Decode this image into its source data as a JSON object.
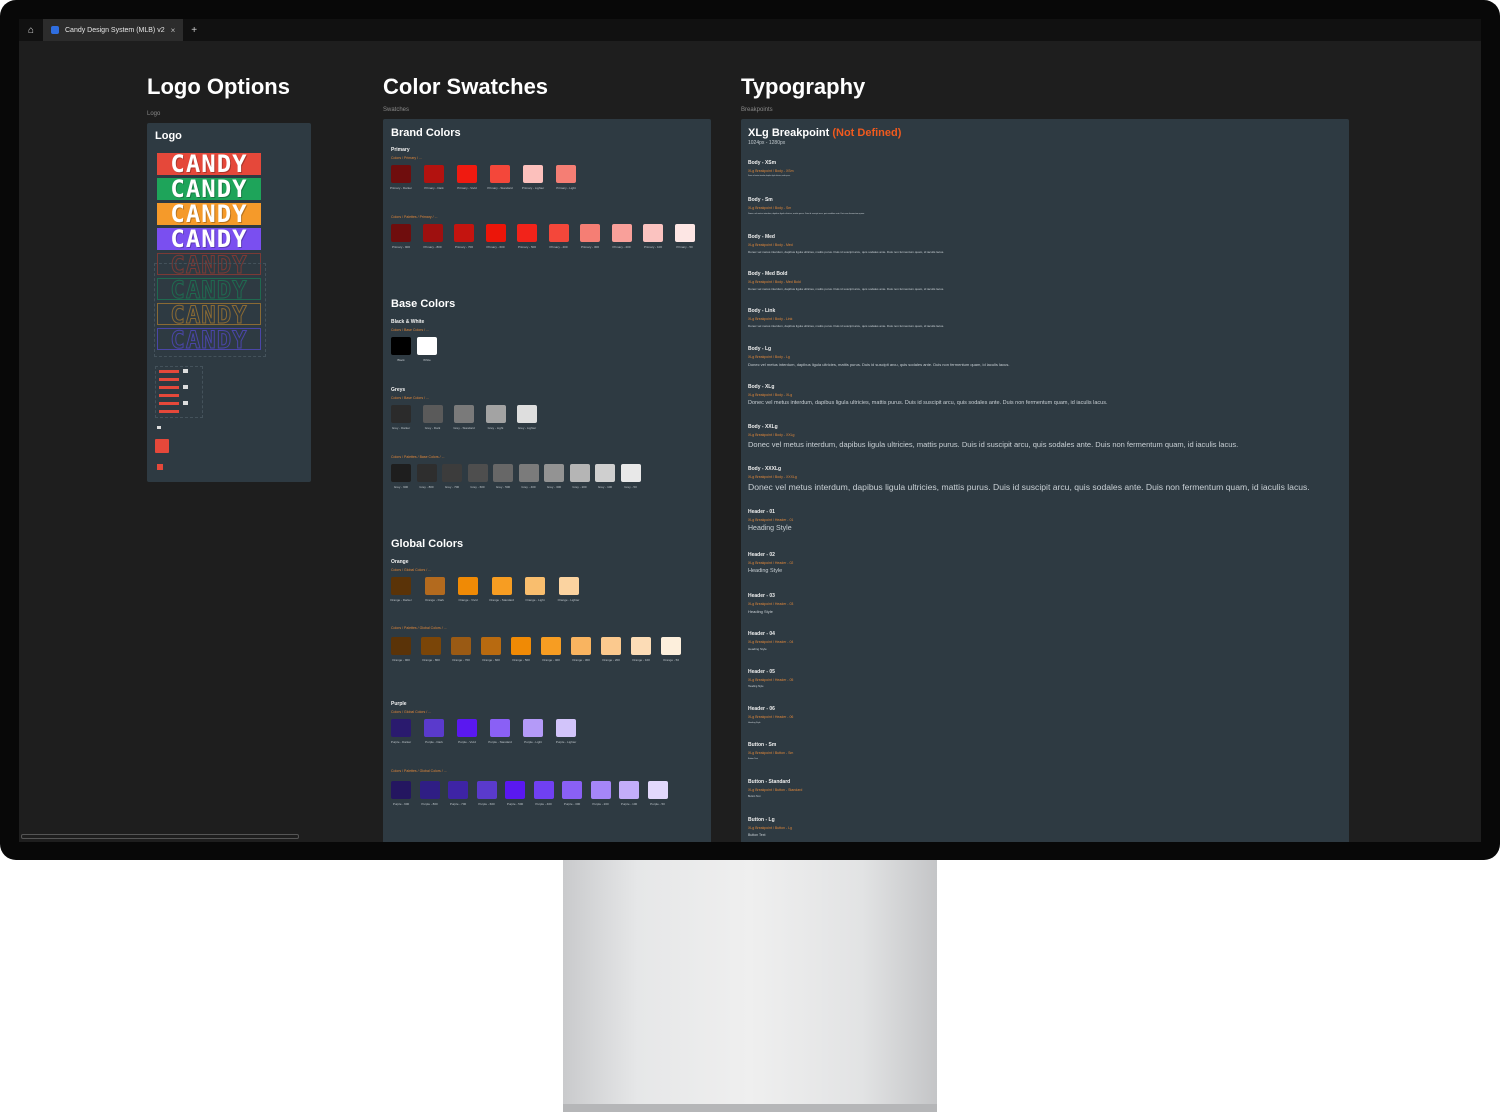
{
  "tab": {
    "title": "Candy Design System (MLB) v2",
    "close": "×",
    "plus": "+"
  },
  "logo_section": {
    "title": "Logo Options",
    "sub": "Logo",
    "panel_title": "Logo",
    "wordmark": "CANDY",
    "filled_colors": [
      "#e5483a",
      "#1ea45a",
      "#f59a2a",
      "#7a4ff0"
    ],
    "outline_colors": [
      "#7a3a36",
      "#1f6a50",
      "#8a6a34",
      "#4a46a8"
    ]
  },
  "swatch_section": {
    "title": "Color Swatches",
    "sub": "Swatches"
  },
  "brand": {
    "title": "Brand Colors",
    "primary_label": "Primary",
    "primary_sub": "Colors / Primary / ...",
    "palette_sub": "Colors / Palettes / Primary / ...",
    "row1": [
      {
        "color": "#6f0d0d",
        "cap": "Primary - Darker"
      },
      {
        "color": "#b3120f",
        "cap": "Primary - Dark"
      },
      {
        "color": "#f01a10",
        "cap": "Primary - Vivid"
      },
      {
        "color": "#f4473a",
        "cap": "Primary - Standard"
      },
      {
        "color": "#fcc0bc",
        "cap": "Primary - Lighter"
      },
      {
        "color": "#f57e74",
        "cap": "Primary - Light"
      }
    ],
    "row2": [
      {
        "color": "#6f0d0d",
        "cap": "Primary - 900"
      },
      {
        "color": "#9e100f",
        "cap": "Primary - 800"
      },
      {
        "color": "#c4140f",
        "cap": "Primary - 700"
      },
      {
        "color": "#ec1509",
        "cap": "Primary - 600"
      },
      {
        "color": "#f2231a",
        "cap": "Primary - 500"
      },
      {
        "color": "#f4473a",
        "cap": "Primary - 400"
      },
      {
        "color": "#f57e74",
        "cap": "Primary - 300"
      },
      {
        "color": "#f9a09a",
        "cap": "Primary - 200"
      },
      {
        "color": "#fbc3c0",
        "cap": "Primary - 100"
      },
      {
        "color": "#fde6e4",
        "cap": "Primary - 50"
      }
    ]
  },
  "base": {
    "title": "Base Colors",
    "bw_label": "Black & White",
    "bw_sub": "Colors / Base Colors / ...",
    "bw": [
      {
        "color": "#000000",
        "cap": "Black"
      },
      {
        "color": "#ffffff",
        "cap": "White"
      }
    ],
    "greys_label": "Greys",
    "greys_sub": "Colors / Base Colors / ...",
    "palette_sub": "Colors / Palettes / Base Colors / ...",
    "greys": [
      {
        "color": "#2b2b2b",
        "cap": "Grey - Darker"
      },
      {
        "color": "#5a5a5a",
        "cap": "Grey - Dark"
      },
      {
        "color": "#7a7a7a",
        "cap": "Grey - Standard"
      },
      {
        "color": "#a3a3a3",
        "cap": "Grey - Light"
      },
      {
        "color": "#dedede",
        "cap": "Grey - Lighter"
      }
    ],
    "greys2": [
      {
        "color": "#1e1e1e",
        "cap": "Grey - 900"
      },
      {
        "color": "#2e2e2e",
        "cap": "Grey - 800"
      },
      {
        "color": "#3c3c3c",
        "cap": "Grey - 700"
      },
      {
        "color": "#4e4e4e",
        "cap": "Grey - 600"
      },
      {
        "color": "#676767",
        "cap": "Grey - 500"
      },
      {
        "color": "#7b7b7b",
        "cap": "Grey - 400"
      },
      {
        "color": "#939393",
        "cap": "Grey - 300"
      },
      {
        "color": "#b5b5b5",
        "cap": "Grey - 200"
      },
      {
        "color": "#cfcfcf",
        "cap": "Grey - 100"
      },
      {
        "color": "#e8e8e8",
        "cap": "Grey - 50"
      }
    ]
  },
  "global": {
    "title": "Global Colors",
    "orange_label": "Orange",
    "orange_sub": "Colors / Global Colors / ...",
    "orange_palette_sub": "Colors / Palettes / Global Colors / ...",
    "orange": [
      {
        "color": "#5a3308",
        "cap": "Orange - Darker"
      },
      {
        "color": "#b36a1e",
        "cap": "Orange - Dark"
      },
      {
        "color": "#f08a05",
        "cap": "Orange - Vivid"
      },
      {
        "color": "#f79d22",
        "cap": "Orange - Standard"
      },
      {
        "color": "#f9be6e",
        "cap": "Orange - Light"
      },
      {
        "color": "#fbd3a0",
        "cap": "Orange - Lighter"
      }
    ],
    "orange2": [
      {
        "color": "#5a3308",
        "cap": "Orange - 900"
      },
      {
        "color": "#7a4508",
        "cap": "Orange - 800"
      },
      {
        "color": "#9a5a14",
        "cap": "Orange - 700"
      },
      {
        "color": "#b86a10",
        "cap": "Orange - 600"
      },
      {
        "color": "#f08a05",
        "cap": "Orange - 500"
      },
      {
        "color": "#f79d22",
        "cap": "Orange - 400"
      },
      {
        "color": "#f9b460",
        "cap": "Orange - 300"
      },
      {
        "color": "#fbc98e",
        "cap": "Orange - 200"
      },
      {
        "color": "#fcdcb6",
        "cap": "Orange - 100"
      },
      {
        "color": "#fdefdc",
        "cap": "Orange - 50"
      }
    ],
    "purple_label": "Purple",
    "purple_sub": "Colors / Global Colors / ...",
    "purple_palette_sub": "Colors / Palettes / Global Colors / ...",
    "purple": [
      {
        "color": "#2a1a6e",
        "cap": "Purple - Darker"
      },
      {
        "color": "#5a3acc",
        "cap": "Purple - Dark"
      },
      {
        "color": "#5a18f0",
        "cap": "Purple - Vivid"
      },
      {
        "color": "#8a60f5",
        "cap": "Purple - Standard"
      },
      {
        "color": "#b49af8",
        "cap": "Purple - Light"
      },
      {
        "color": "#d2c4fa",
        "cap": "Purple - Lighter"
      }
    ],
    "purple2": [
      {
        "color": "#241660",
        "cap": "Purple - 900"
      },
      {
        "color": "#2f1e84",
        "cap": "Purple - 800"
      },
      {
        "color": "#3e24a6",
        "cap": "Purple - 700"
      },
      {
        "color": "#5a3acc",
        "cap": "Purple - 600"
      },
      {
        "color": "#5a18f0",
        "cap": "Purple - 500"
      },
      {
        "color": "#7040f2",
        "cap": "Purple - 400"
      },
      {
        "color": "#8a60f5",
        "cap": "Purple - 300"
      },
      {
        "color": "#a586f7",
        "cap": "Purple - 200"
      },
      {
        "color": "#c3adf9",
        "cap": "Purple - 100"
      },
      {
        "color": "#e2d8fc",
        "cap": "Purple - 50"
      }
    ]
  },
  "typo_section": {
    "title": "Typography",
    "sub": "Breakpoints"
  },
  "typo": {
    "title": "XLg Breakpoint",
    "title_highlight": "(Not Defined)",
    "range": "1024px - 1280px",
    "sample_text": "Donec vel metus interdum, dapibus ligula ultricies, mattis purus. Duis id suscipit arcu, quis sodales ante. Duis non fermentum quam, id iaculis lacus.",
    "items": [
      {
        "label": "Body - XSm",
        "path": "XLg Breakpoint / Body - XSm",
        "sample": "Donec vel metus interdum, dapibus ligula ultricies, mattis purus.",
        "size": 1.5
      },
      {
        "label": "Body - Sm",
        "path": "XLg Breakpoint / Body - Sm",
        "sample": "Donec vel metus interdum, dapibus ligula ultricies, mattis purus. Duis id suscipit arcu, quis sodales ante. Duis non fermentum quam.",
        "size": 2
      },
      {
        "label": "Body - Med",
        "path": "XLg Breakpoint / Body - Med",
        "sample": "Donec vel metus interdum, dapibus ligula ultricies, mattis purus. Duis id suscipit arcu, quis sodales ante. Duis non fermentum quam, id iaculis lacus.",
        "size": 3
      },
      {
        "label": "Body - Med Bold",
        "path": "XLg Breakpoint / Body - Med Bold",
        "sample": "Donec vel metus interdum, dapibus ligula ultricies, mattis purus. Duis id suscipit arcu, quis sodales ante. Duis non fermentum quam, id iaculis lacus.",
        "size": 3
      },
      {
        "label": "Body - Link",
        "path": "XLg Breakpoint / Body - Link",
        "sample": "Donec vel metus interdum, dapibus ligula ultricies, mattis purus. Duis id suscipit arcu, quis sodales ante. Duis non fermentum quam, id iaculis lacus.",
        "size": 3
      },
      {
        "label": "Body - Lg",
        "path": "XLg Breakpoint / Body - Lg",
        "sample": "Donec vel metus interdum, dapibus ligula ultricies, mattis purus. Duis id suscipit arcu, quis sodales ante. Duis non fermentum quam, id iaculis lacus.",
        "size": 4
      },
      {
        "label": "Body - XLg",
        "path": "XLg Breakpoint / Body - XLg",
        "sample": "Donec vel metus interdum, dapibus ligula ultricies, mattis purus. Duis id suscipit arcu, quis sodales ante. Duis non fermentum quam, id iaculis lacus.",
        "size": 5.5
      },
      {
        "label": "Body - XXLg",
        "path": "XLg Breakpoint / Body - XXLg",
        "sample": "Donec vel metus interdum, dapibus ligula ultricies, mattis purus. Duis id suscipit arcu, quis sodales ante. Duis non fermentum quam, id iaculis lacus.",
        "size": 7.5
      },
      {
        "label": "Body - XXXLg",
        "path": "XLg Breakpoint / Body - XXXLg",
        "sample": "Donec vel metus interdum, dapibus ligula ultricies, mattis purus. Duis id suscipit arcu, quis sodales ante. Duis non fermentum quam, id iaculis lacus.",
        "size": 8.6
      },
      {
        "label": "Header - 01",
        "path": "XLg Breakpoint / Header - 01",
        "sample": "Heading Style",
        "size": 7
      },
      {
        "label": "Header - 02",
        "path": "XLg Breakpoint / Header - 02",
        "sample": "Heading Style",
        "size": 5.5
      },
      {
        "label": "Header - 03",
        "path": "XLg Breakpoint / Header - 03",
        "sample": "Heading Style",
        "size": 4
      },
      {
        "label": "Header - 04",
        "path": "XLg Breakpoint / Header - 04",
        "sample": "Heading Style",
        "size": 3
      },
      {
        "label": "Header - 05",
        "path": "XLg Breakpoint / Header - 05",
        "sample": "Heading Style",
        "size": 2.5
      },
      {
        "label": "Header - 06",
        "path": "XLg Breakpoint / Header - 06",
        "sample": "Heading Style",
        "size": 2
      },
      {
        "label": "Button - Sm",
        "path": "XLg Breakpoint / Button - Sm",
        "sample": "Button Text",
        "size": 2
      },
      {
        "label": "Button - Standard",
        "path": "XLg Breakpoint / Button - Standard",
        "sample": "Button Text",
        "size": 2.5
      },
      {
        "label": "Button - Lg",
        "path": "XLg Breakpoint / Button - Lg",
        "sample": "Button Text",
        "size": 3.5
      }
    ]
  }
}
